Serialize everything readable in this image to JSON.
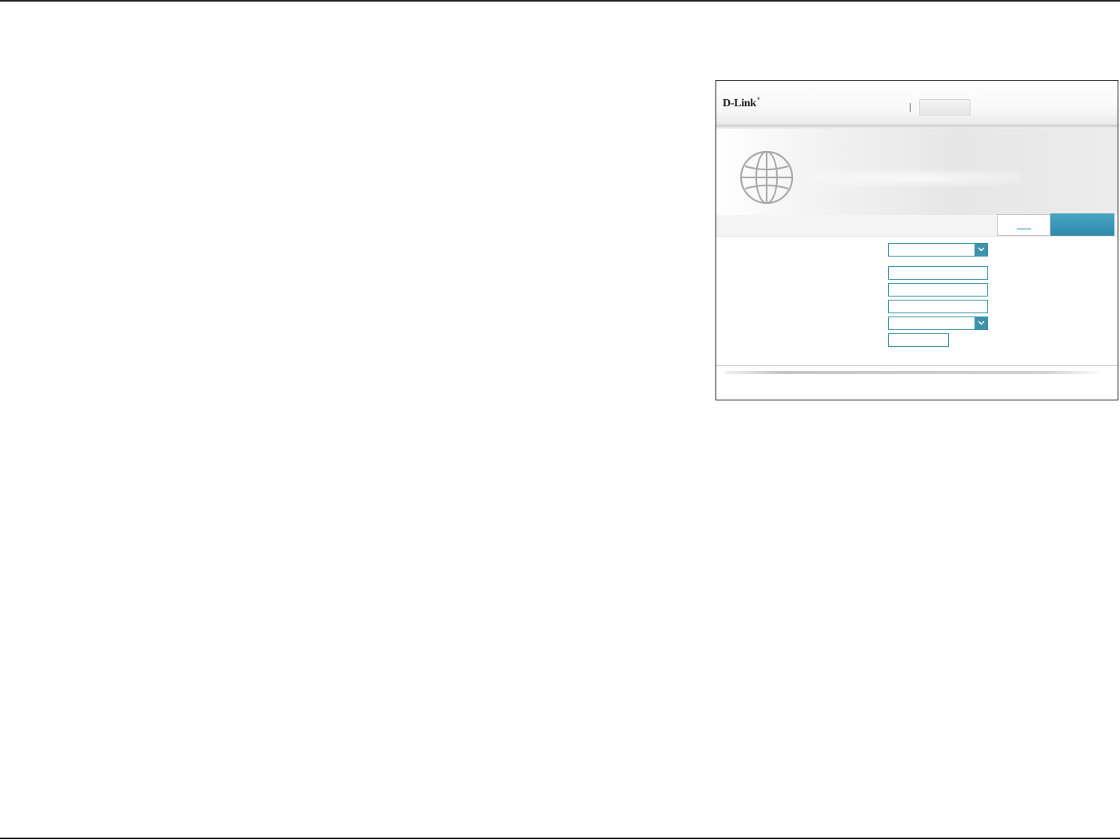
{
  "screenshot": {
    "brand": {
      "logo_text": "D-Link",
      "logo_mark": "®"
    },
    "nav": {
      "tab_label": ""
    },
    "banner": {
      "icon": "globe-icon"
    },
    "toolbar": {
      "secondary_button_label": "",
      "primary_button_label": ""
    },
    "form": {
      "fields": [
        {
          "kind": "select",
          "value": "",
          "icon": "chevron-down-icon"
        },
        {
          "kind": "text",
          "value": ""
        },
        {
          "kind": "text",
          "value": ""
        },
        {
          "kind": "text",
          "value": ""
        },
        {
          "kind": "select",
          "value": "",
          "icon": "chevron-down-icon"
        },
        {
          "kind": "text",
          "value": ""
        }
      ]
    }
  },
  "colors": {
    "accent": "#3d93ab",
    "primary_button": "#2d8aab",
    "rule": "#231f20"
  }
}
